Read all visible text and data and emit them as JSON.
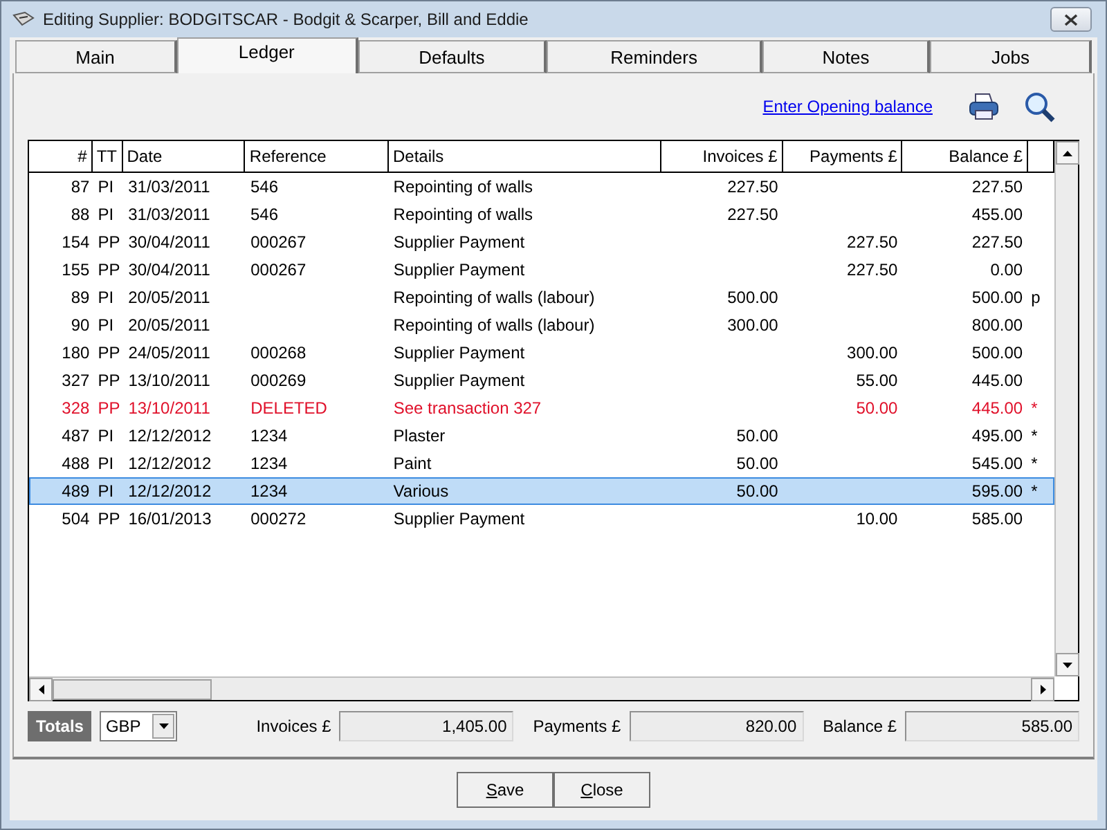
{
  "window": {
    "title": "Editing Supplier: BODGITSCAR - Bodgit & Scarper, Bill and Eddie"
  },
  "tabs": [
    {
      "label": "Main",
      "selected": false
    },
    {
      "label": "Ledger",
      "selected": true
    },
    {
      "label": "Defaults",
      "selected": false
    },
    {
      "label": "Reminders",
      "selected": false
    },
    {
      "label": "Notes",
      "selected": false
    },
    {
      "label": "Jobs",
      "selected": false
    }
  ],
  "toolbar": {
    "link": "Enter Opening balance"
  },
  "table": {
    "columns": [
      "#",
      "TT",
      "Date",
      "Reference",
      "Details",
      "Invoices £",
      "Payments £",
      "Balance £"
    ],
    "rows": [
      {
        "num": "87",
        "tt": "PI",
        "date": "31/03/2011",
        "reference": "546",
        "details": "Repointing of walls",
        "invoices": "227.50",
        "payments": "",
        "balance": "227.50",
        "flag": "",
        "deleted": false,
        "selected": false
      },
      {
        "num": "88",
        "tt": "PI",
        "date": "31/03/2011",
        "reference": "546",
        "details": "Repointing of walls",
        "invoices": "227.50",
        "payments": "",
        "balance": "455.00",
        "flag": "",
        "deleted": false,
        "selected": false
      },
      {
        "num": "154",
        "tt": "PP",
        "date": "30/04/2011",
        "reference": "000267",
        "details": "Supplier Payment",
        "invoices": "",
        "payments": "227.50",
        "balance": "227.50",
        "flag": "",
        "deleted": false,
        "selected": false
      },
      {
        "num": "155",
        "tt": "PP",
        "date": "30/04/2011",
        "reference": "000267",
        "details": "Supplier Payment",
        "invoices": "",
        "payments": "227.50",
        "balance": "0.00",
        "flag": "",
        "deleted": false,
        "selected": false
      },
      {
        "num": "89",
        "tt": "PI",
        "date": "20/05/2011",
        "reference": "",
        "details": "Repointing of walls (labour)",
        "invoices": "500.00",
        "payments": "",
        "balance": "500.00",
        "flag": "p",
        "deleted": false,
        "selected": false
      },
      {
        "num": "90",
        "tt": "PI",
        "date": "20/05/2011",
        "reference": "",
        "details": "Repointing of walls (labour)",
        "invoices": "300.00",
        "payments": "",
        "balance": "800.00",
        "flag": "",
        "deleted": false,
        "selected": false
      },
      {
        "num": "180",
        "tt": "PP",
        "date": "24/05/2011",
        "reference": "000268",
        "details": "Supplier Payment",
        "invoices": "",
        "payments": "300.00",
        "balance": "500.00",
        "flag": "",
        "deleted": false,
        "selected": false
      },
      {
        "num": "327",
        "tt": "PP",
        "date": "13/10/2011",
        "reference": "000269",
        "details": "Supplier Payment",
        "invoices": "",
        "payments": "55.00",
        "balance": "445.00",
        "flag": "",
        "deleted": false,
        "selected": false
      },
      {
        "num": "328",
        "tt": "PP",
        "date": "13/10/2011",
        "reference": "DELETED",
        "details": "See transaction 327",
        "invoices": "",
        "payments": "50.00",
        "balance": "445.00",
        "flag": "*",
        "deleted": true,
        "selected": false
      },
      {
        "num": "487",
        "tt": "PI",
        "date": "12/12/2012",
        "reference": "1234",
        "details": "Plaster",
        "invoices": "50.00",
        "payments": "",
        "balance": "495.00",
        "flag": "*",
        "deleted": false,
        "selected": false
      },
      {
        "num": "488",
        "tt": "PI",
        "date": "12/12/2012",
        "reference": "1234",
        "details": "Paint",
        "invoices": "50.00",
        "payments": "",
        "balance": "545.00",
        "flag": "*",
        "deleted": false,
        "selected": false
      },
      {
        "num": "489",
        "tt": "PI",
        "date": "12/12/2012",
        "reference": "1234",
        "details": "Various",
        "invoices": "50.00",
        "payments": "",
        "balance": "595.00",
        "flag": "*",
        "deleted": false,
        "selected": true
      },
      {
        "num": "504",
        "tt": "PP",
        "date": "16/01/2013",
        "reference": "000272",
        "details": "Supplier Payment",
        "invoices": "",
        "payments": "10.00",
        "balance": "585.00",
        "flag": "",
        "deleted": false,
        "selected": false
      }
    ]
  },
  "totals": {
    "label": "Totals",
    "currency": "GBP",
    "fields": [
      {
        "label": "Invoices £",
        "value": "1,405.00"
      },
      {
        "label": "Payments £",
        "value": "820.00"
      },
      {
        "label": "Balance £",
        "value": "585.00"
      }
    ]
  },
  "buttons": [
    "Save",
    "Close"
  ]
}
